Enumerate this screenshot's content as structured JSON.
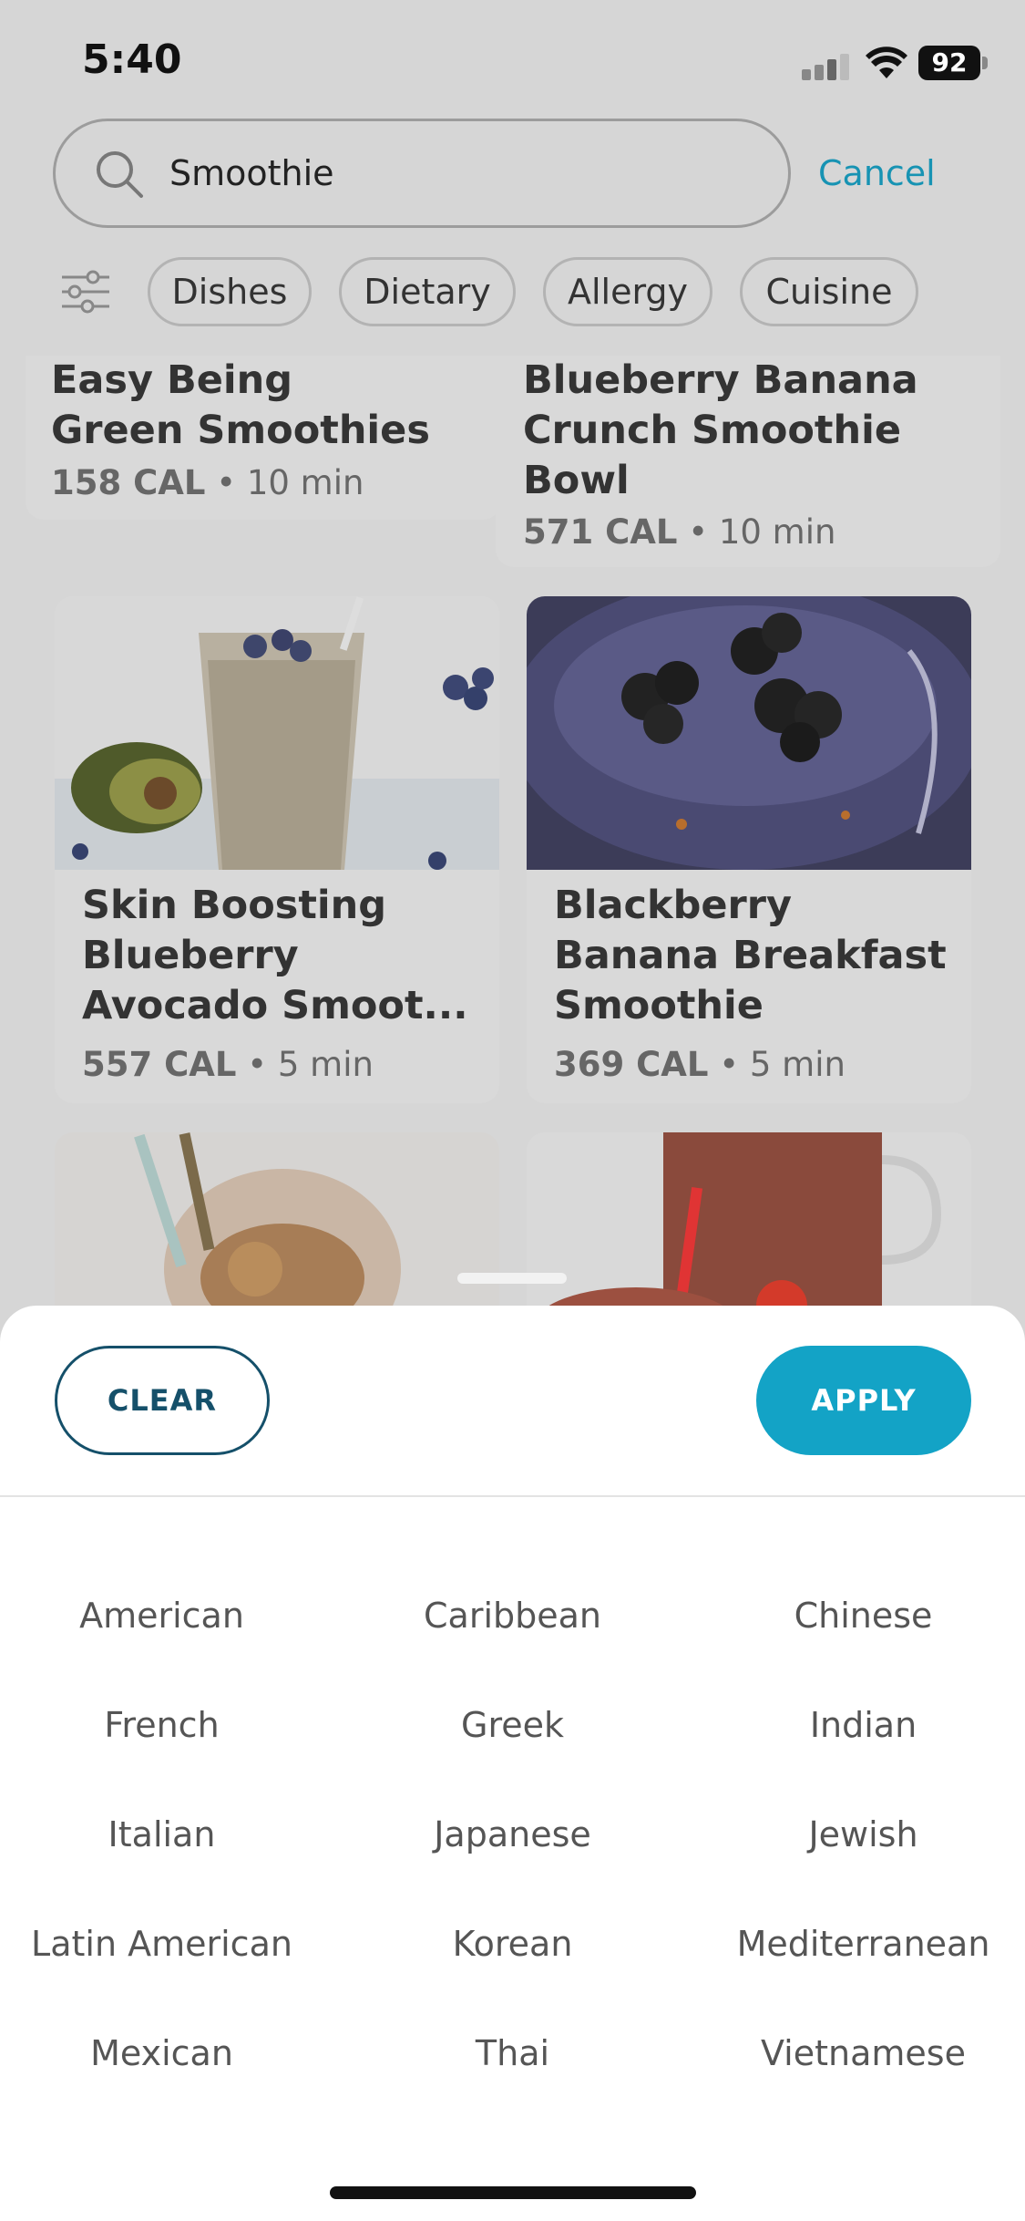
{
  "status_bar": {
    "time": "5:40",
    "battery": "92"
  },
  "search": {
    "value": "Smoothie",
    "cancel_label": "Cancel"
  },
  "filters": [
    "Dishes",
    "Dietary",
    "Allergy",
    "Cuisine"
  ],
  "recipes": [
    {
      "title_lines": [
        "Easy Being",
        "Green Smoothies"
      ],
      "cal": "158 CAL",
      "time": "10 min"
    },
    {
      "title_lines": [
        "Blueberry Banana",
        "Crunch Smoothie",
        "Bowl"
      ],
      "cal": "571 CAL",
      "time": "10 min"
    },
    {
      "title_lines": [
        "Skin Boosting",
        "Blueberry",
        "Avocado Smoot..."
      ],
      "cal": "557 CAL",
      "time": "5 min"
    },
    {
      "title_lines": [
        "Blackberry",
        "Banana Breakfast",
        "Smoothie"
      ],
      "cal": "369 CAL",
      "time": "5 min"
    }
  ],
  "sheet": {
    "clear_label": "CLEAR",
    "apply_label": "APPLY",
    "cuisines": [
      [
        "American",
        "Caribbean",
        "Chinese"
      ],
      [
        "French",
        "Greek",
        "Indian"
      ],
      [
        "Italian",
        "Japanese",
        "Jewish"
      ],
      [
        "Latin American",
        "Korean",
        "Mediterranean"
      ],
      [
        "Mexican",
        "Thai",
        "Vietnamese"
      ]
    ]
  },
  "colors": {
    "accent": "#13a3c6",
    "accent_dark": "#15506a",
    "link": "#1793b3"
  }
}
